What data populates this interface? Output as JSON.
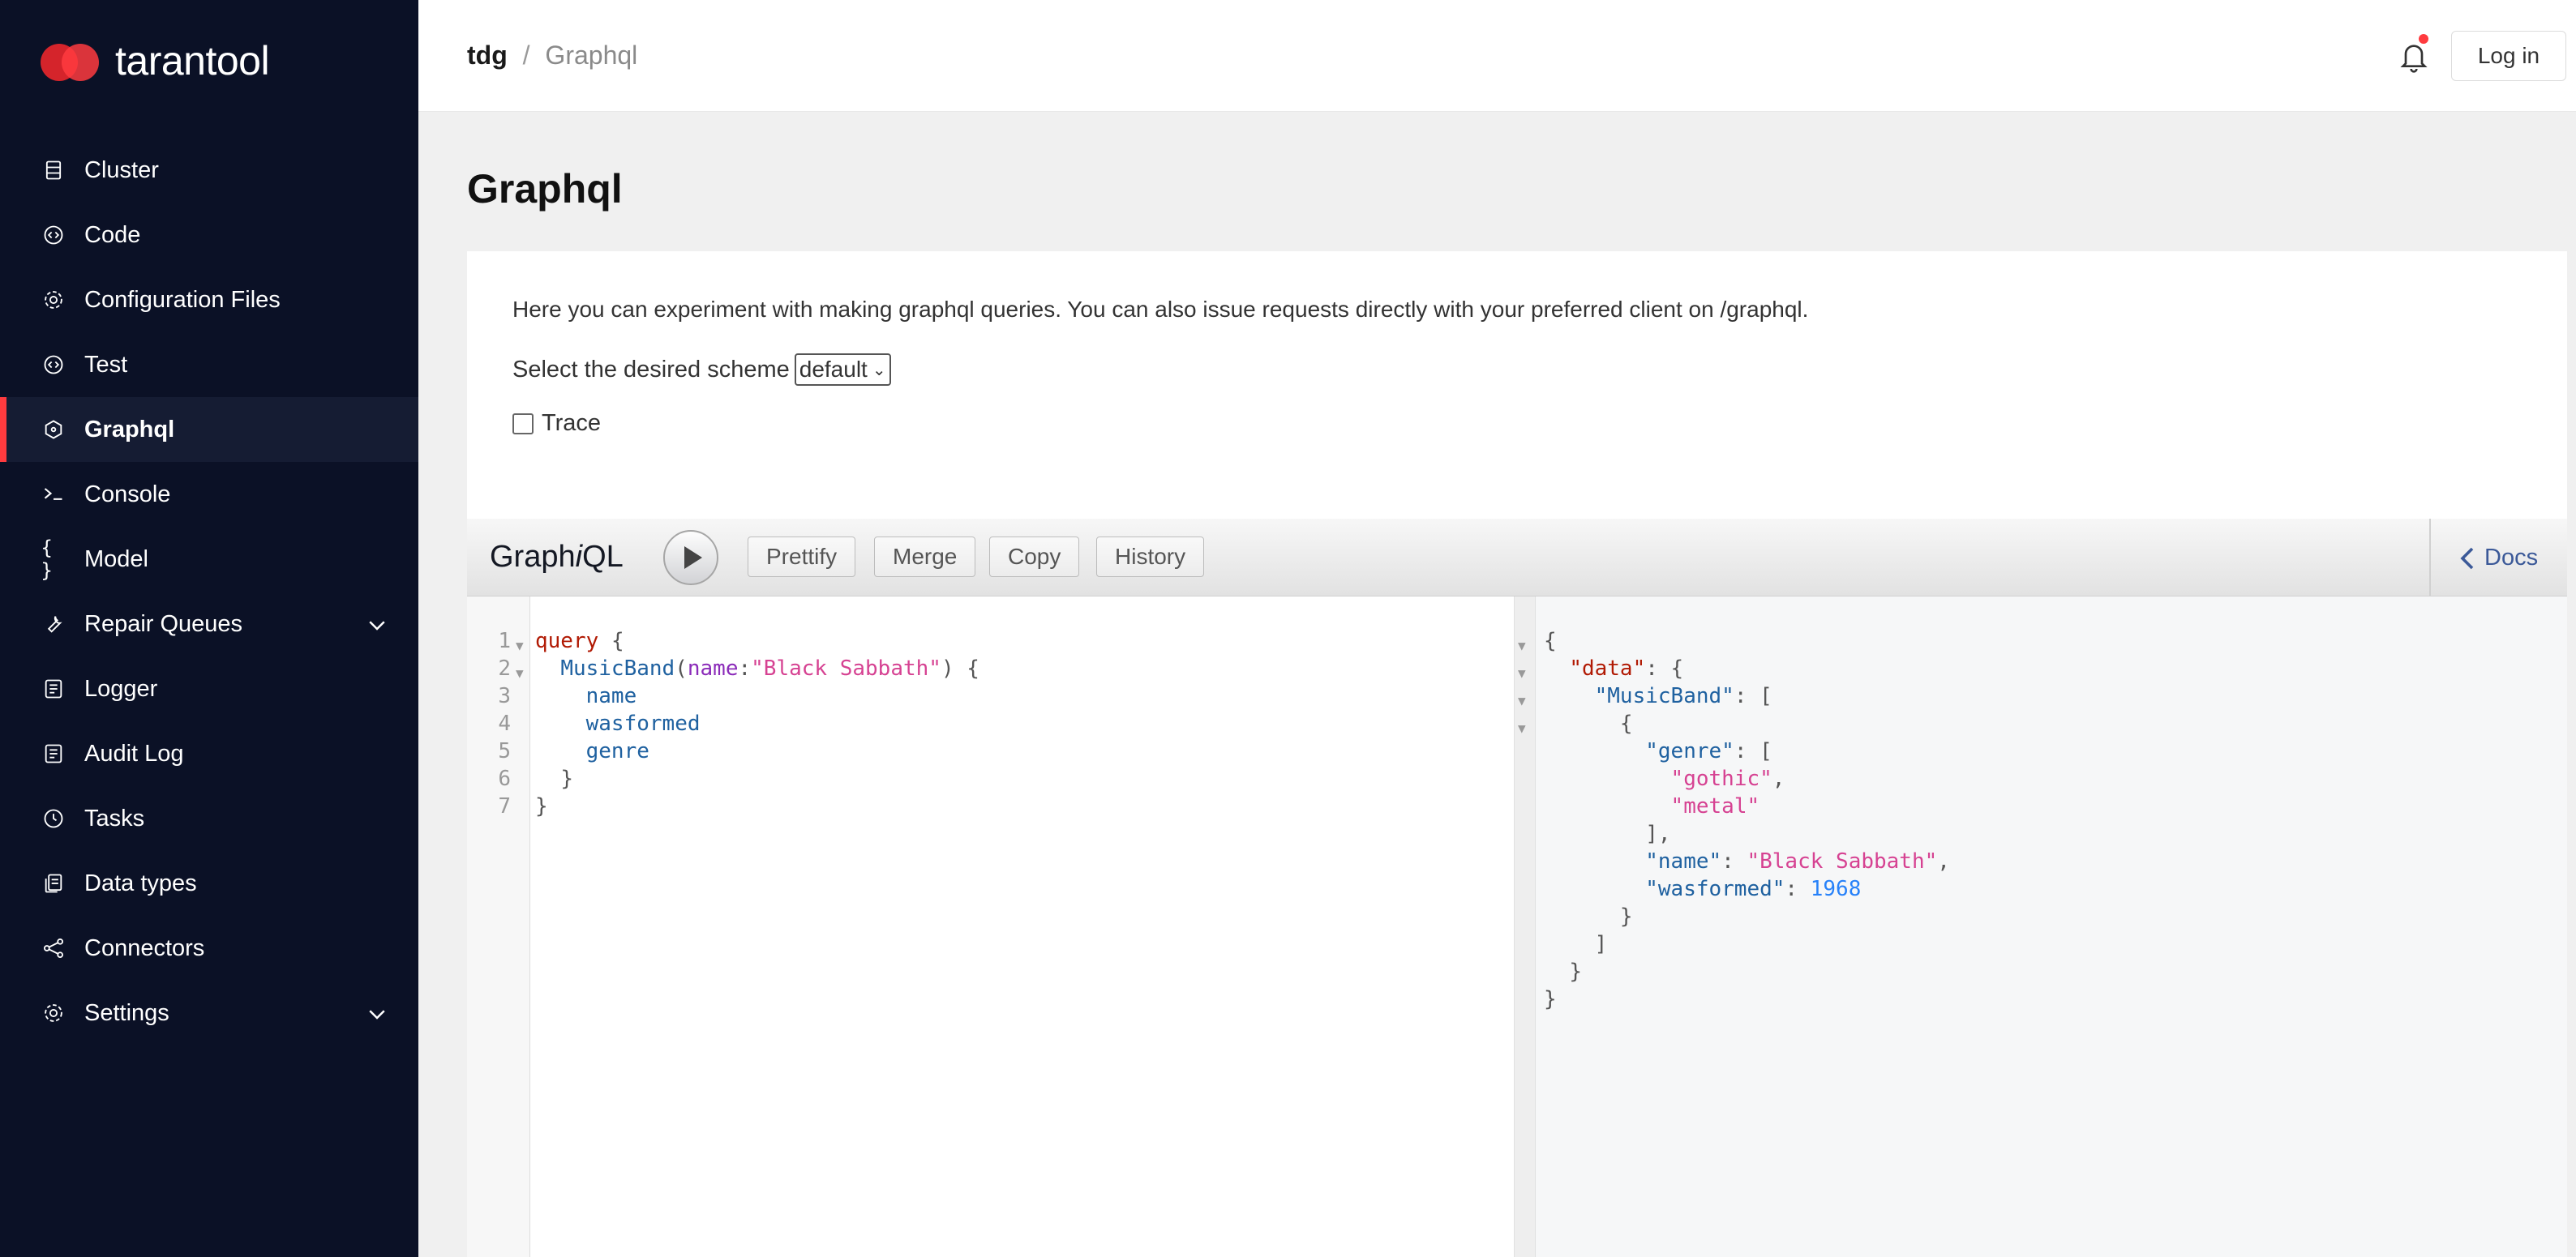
{
  "app": {
    "logo_text": "tarantool"
  },
  "sidebar": {
    "items": [
      {
        "label": "Cluster",
        "icon": "cluster-icon"
      },
      {
        "label": "Code",
        "icon": "code-icon"
      },
      {
        "label": "Configuration Files",
        "icon": "gear-icon"
      },
      {
        "label": "Test",
        "icon": "code-icon"
      },
      {
        "label": "Graphql",
        "icon": "graphql-icon",
        "active": true
      },
      {
        "label": "Console",
        "icon": "terminal-icon"
      },
      {
        "label": "Model",
        "icon": "braces-icon"
      },
      {
        "label": "Repair Queues",
        "icon": "wrench-icon",
        "expandable": true
      },
      {
        "label": "Logger",
        "icon": "document-icon"
      },
      {
        "label": "Audit Log",
        "icon": "document-icon"
      },
      {
        "label": "Tasks",
        "icon": "clock-icon"
      },
      {
        "label": "Data types",
        "icon": "files-icon"
      },
      {
        "label": "Connectors",
        "icon": "share-icon"
      },
      {
        "label": "Settings",
        "icon": "gear-icon",
        "expandable": true
      }
    ]
  },
  "header": {
    "breadcrumb_root": "tdg",
    "breadcrumb_sep": "/",
    "breadcrumb_current": "Graphql",
    "login_label": "Log in",
    "notification_dot_color": "#ff3b3f"
  },
  "page": {
    "title": "Graphql",
    "description": "Here you can experiment with making graphql queries. You can also issue requests directly with your preferred client on /graphql.",
    "scheme_label": "Select the desired scheme",
    "scheme_value": "default",
    "trace_label": "Trace",
    "trace_checked": false
  },
  "graphiql": {
    "title_prefix": "Graph",
    "title_italic": "i",
    "title_suffix": "QL",
    "buttons": {
      "prettify": "Prettify",
      "merge": "Merge",
      "copy": "Copy",
      "history": "History"
    },
    "docs_label": "Docs",
    "query": {
      "line_numbers": [
        "1",
        "2",
        "3",
        "4",
        "5",
        "6",
        "7"
      ],
      "keyword": "query",
      "field": "MusicBand",
      "arg_name": "name",
      "arg_value": "\"Black Sabbath\"",
      "subfields": [
        "name",
        "wasformed",
        "genre"
      ]
    },
    "result": {
      "key_data": "\"data\"",
      "key_musicband": "\"MusicBand\"",
      "key_genre": "\"genre\"",
      "genre_values": [
        "\"gothic\"",
        "\"metal\""
      ],
      "key_name": "\"name\"",
      "name_value": "\"Black Sabbath\"",
      "key_wasformed": "\"wasformed\"",
      "wasformed_value": "1968"
    }
  },
  "colors": {
    "sidebar_bg": "#0b1126",
    "accent": "#ff3b3f",
    "main_bg": "#f0f0f0"
  }
}
